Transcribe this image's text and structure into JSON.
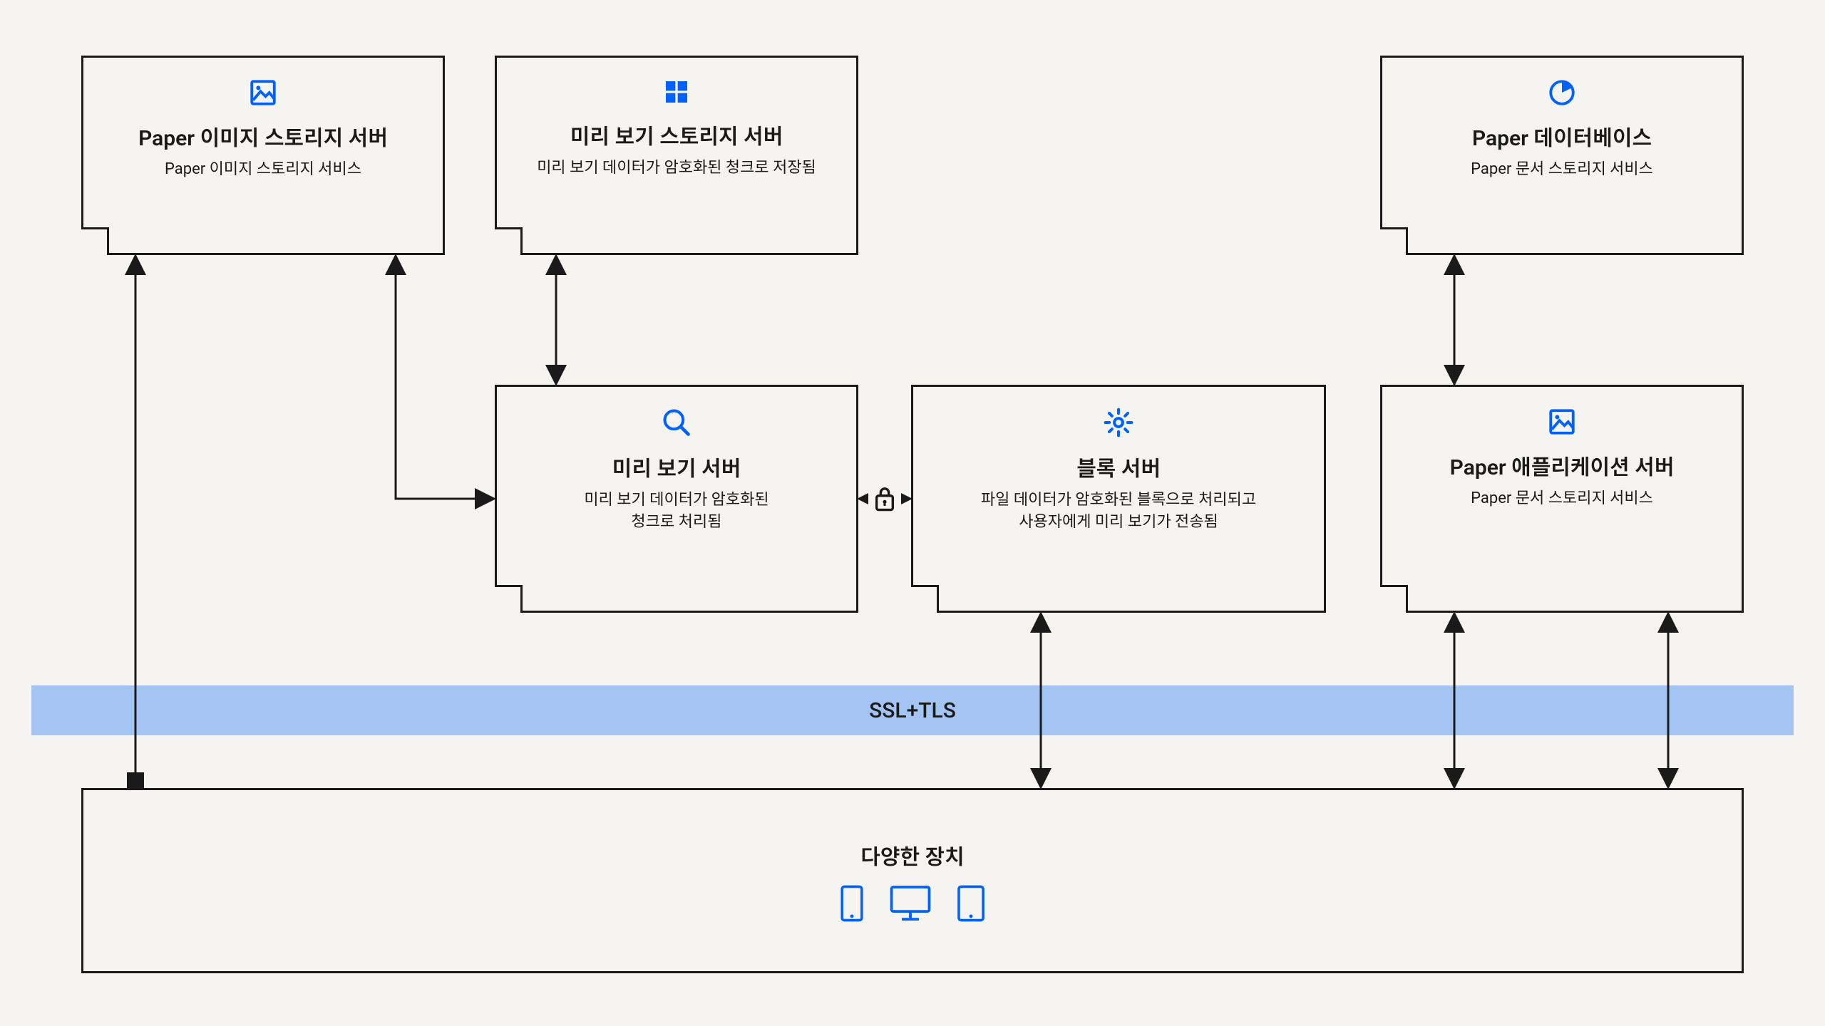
{
  "boxes": {
    "paper_image_storage": {
      "title": "Paper 이미지 스토리지 서버",
      "subtitle": "Paper 이미지 스토리지 서비스"
    },
    "preview_storage": {
      "title": "미리 보기 스토리지 서버",
      "subtitle": "미리 보기 데이터가 암호화된 청크로 저장됨"
    },
    "paper_database": {
      "title": "Paper 데이터베이스",
      "subtitle": "Paper 문서 스토리지 서비스"
    },
    "preview_server": {
      "title": "미리 보기 서버",
      "subtitle": "미리 보기 데이터가 암호화된\n청크로 처리됨"
    },
    "block_server": {
      "title": "블록 서버",
      "subtitle": "파일 데이터가 암호화된 블록으로 처리되고\n사용자에게 미리 보기가 전송됨"
    },
    "paper_app_server": {
      "title": "Paper 애플리케이션 서버",
      "subtitle": "Paper 문서 스토리지 서비스"
    }
  },
  "ssl_bar": {
    "label": "SSL+TLS"
  },
  "devices": {
    "title": "다양한 장치"
  },
  "colors": {
    "accent": "#0061fe",
    "ssl": "#a4c5f4",
    "stroke": "#1a1a1a"
  }
}
